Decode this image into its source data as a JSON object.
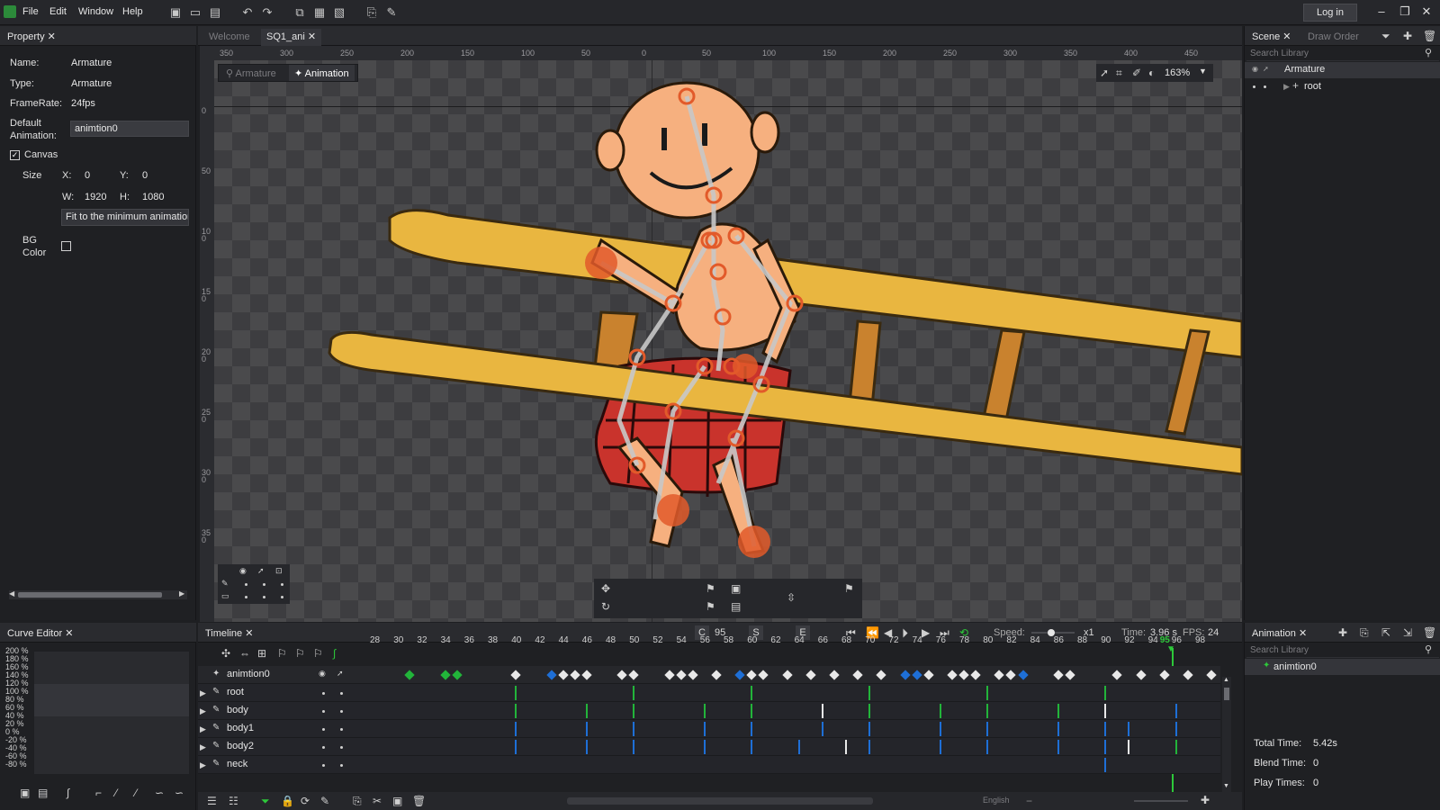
{
  "menu": {
    "file": "File",
    "edit": "Edit",
    "window": "Window",
    "help": "Help",
    "login": "Log in"
  },
  "property": {
    "tab": "Property",
    "name_label": "Name:",
    "name_value": "Armature",
    "type_label": "Type:",
    "type_value": "Armature",
    "framerate_label": "FrameRate:",
    "framerate_value": "24fps",
    "default_anim_label_1": "Default",
    "default_anim_label_2": "Animation:",
    "default_anim_value": "animtion0",
    "canvas_label": "Canvas",
    "size_label": "Size",
    "x_label": "X:",
    "x_value": "0",
    "y_label": "Y:",
    "y_value": "0",
    "w_label": "W:",
    "w_value": "1920",
    "h_label": "H:",
    "h_value": "1080",
    "fit_button": "Fit to the minimum animation",
    "bg_label_1": "BG",
    "bg_label_2": "Color"
  },
  "editor_tabs": [
    {
      "label": "Welcome",
      "active": false
    },
    {
      "label": "SQ1_ani",
      "active": true
    }
  ],
  "viewport": {
    "mode_armature": "Armature",
    "mode_animation": "Animation",
    "zoom": "163%",
    "hruler_labels": [
      "350",
      "300",
      "250",
      "200",
      "150",
      "100",
      "50",
      "0",
      "50",
      "100",
      "150",
      "200",
      "250",
      "300",
      "350",
      "400",
      "450"
    ],
    "vruler_labels": [
      "0",
      "50",
      "100",
      "150",
      "200",
      "250",
      "300",
      "350"
    ]
  },
  "scene": {
    "tab_scene": "Scene",
    "tab_draw_order": "Draw Order",
    "search_placeholder": "Search Library",
    "armature": "Armature",
    "root": "root"
  },
  "curve_editor": {
    "tab": "Curve Editor",
    "labels": [
      "200 %",
      "180 %",
      "160 %",
      "140 %",
      "120 %",
      "100 %",
      "80 %",
      "60 %",
      "40 %",
      "20 %",
      "0 %",
      "-20 %",
      "-40 %",
      "-60 %",
      "-80 %"
    ]
  },
  "timeline": {
    "tab": "Timeline",
    "current_label": "C",
    "current_frame": "95",
    "start_label": "S",
    "end_label": "E",
    "speed_label": "Speed:",
    "speed_value": "x1",
    "time_label": "Time:",
    "time_value": "3.96 s",
    "fps_label": "FPS:",
    "fps_value": "24",
    "frame_numbers": [
      "28",
      "30",
      "32",
      "34",
      "36",
      "38",
      "40",
      "42",
      "44",
      "46",
      "48",
      "50",
      "52",
      "54",
      "56",
      "58",
      "60",
      "62",
      "64",
      "66",
      "68",
      "70",
      "72",
      "74",
      "76",
      "78",
      "80",
      "82",
      "84",
      "86",
      "88",
      "90",
      "92",
      "94",
      "95",
      "96",
      "98"
    ],
    "rows": [
      "animtion0",
      "root",
      "body",
      "body1",
      "body2",
      "neck"
    ],
    "language": "English"
  },
  "animation": {
    "tab": "Animation",
    "search_placeholder": "Search Library",
    "item": "animtion0",
    "total_time_label": "Total Time:",
    "total_time_value": "5.42s",
    "blend_time_label": "Blend Time:",
    "blend_time_value": "0",
    "play_times_label": "Play Times:",
    "play_times_value": "0"
  },
  "colors": {
    "key_green": "#22b43a",
    "key_blue": "#1e6fd6",
    "key_white": "#e8e8e8",
    "playhead": "#2dc83a",
    "bone": "#c8c8c8",
    "joint": "#e25a2a"
  }
}
